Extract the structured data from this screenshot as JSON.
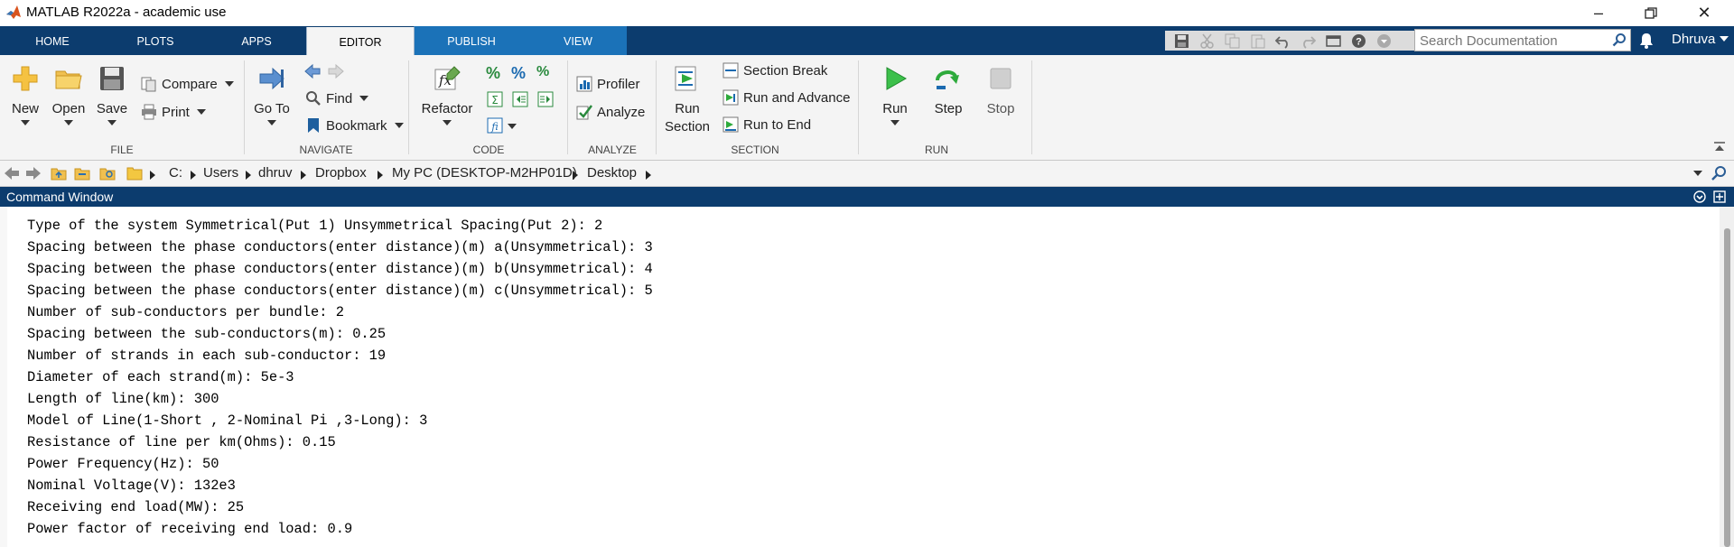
{
  "window": {
    "title": "MATLAB R2022a - academic use"
  },
  "tabs": [
    {
      "label": "HOME"
    },
    {
      "label": "PLOTS"
    },
    {
      "label": "APPS"
    },
    {
      "label": "EDITOR",
      "active": true
    },
    {
      "label": "PUBLISH"
    },
    {
      "label": "VIEW"
    }
  ],
  "search": {
    "placeholder": "Search Documentation"
  },
  "user": {
    "name": "Dhruva"
  },
  "ribbon": {
    "file": {
      "label": "FILE",
      "new": "New",
      "open": "Open",
      "save": "Save",
      "compare": "Compare",
      "print": "Print"
    },
    "navigate": {
      "label": "NAVIGATE",
      "goto": "Go To",
      "find": "Find",
      "bookmark": "Bookmark"
    },
    "code": {
      "label": "CODE",
      "refactor": "Refactor"
    },
    "analyze": {
      "label": "ANALYZE",
      "profiler": "Profiler",
      "analyze": "Analyze"
    },
    "section": {
      "label": "SECTION",
      "run_section_1": "Run",
      "run_section_2": "Section",
      "section_break": "Section Break",
      "run_and_advance": "Run and Advance",
      "run_to_end": "Run to End"
    },
    "run": {
      "label": "RUN",
      "run": "Run",
      "step": "Step",
      "stop": "Stop"
    }
  },
  "path": {
    "crumbs": [
      "C:",
      "Users",
      "dhruv",
      "Dropbox",
      "My PC (DESKTOP-M2HP01D)",
      "Desktop"
    ]
  },
  "command_window": {
    "title": "Command Window",
    "lines": [
      "Type of the system Symmetrical(Put 1) Unsymmetrical Spacing(Put 2): 2",
      "Spacing between the phase conductors(enter distance)(m) a(Unsymmetrical): 3",
      "Spacing between the phase conductors(enter distance)(m) b(Unsymmetrical): 4",
      "Spacing between the phase conductors(enter distance)(m) c(Unsymmetrical): 5",
      "Number of sub-conductors per bundle: 2",
      "Spacing between the sub-conductors(m): 0.25",
      "Number of strands in each sub-conductor: 19",
      "Diameter of each strand(m): 5e-3",
      "Length of line(km): 300",
      "Model of Line(1-Short , 2-Nominal Pi ,3-Long): 3",
      "Resistance of line per km(Ohms): 0.15",
      "Power Frequency(Hz): 50",
      "Nominal Voltage(V): 132e3",
      "Receiving end load(MW): 25",
      "Power factor of receiving end load: 0.9"
    ]
  },
  "colors": {
    "tabstrip": "#0c3c6e",
    "accent_tabs": "#1b72b8",
    "ribbon": "#f4f4f4"
  }
}
